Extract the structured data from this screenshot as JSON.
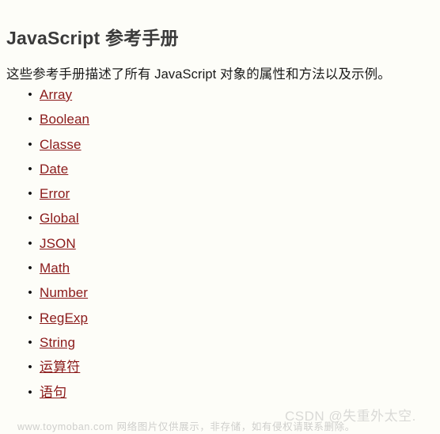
{
  "document": {
    "title": "JavaScript 参考手册",
    "intro": "这些参考手册描述了所有 JavaScript 对象的属性和方法以及示例。",
    "bullet_glyph": "•",
    "links": [
      {
        "label": "Array"
      },
      {
        "label": "Boolean"
      },
      {
        "label": "Classe"
      },
      {
        "label": "Date"
      },
      {
        "label": "Error"
      },
      {
        "label": "Global"
      },
      {
        "label": "JSON"
      },
      {
        "label": "Math"
      },
      {
        "label": "Number"
      },
      {
        "label": "RegExp"
      },
      {
        "label": "String"
      },
      {
        "label": "运算符"
      },
      {
        "label": "语句"
      }
    ]
  },
  "footer": {
    "disclaimer": "www.toymoban.com 网络图片仅供展示，非存储，如有侵权请联系删除。",
    "watermark": "CSDN @失重外太空."
  },
  "colors": {
    "background": "#fdfdf8",
    "heading": "#3b3b3b",
    "body_text": "#1a1a1a",
    "link": "#8b1a1a",
    "bullet": "#111111",
    "footer_text": "#cfcfcc",
    "watermark_text": "#d9d9d6"
  }
}
